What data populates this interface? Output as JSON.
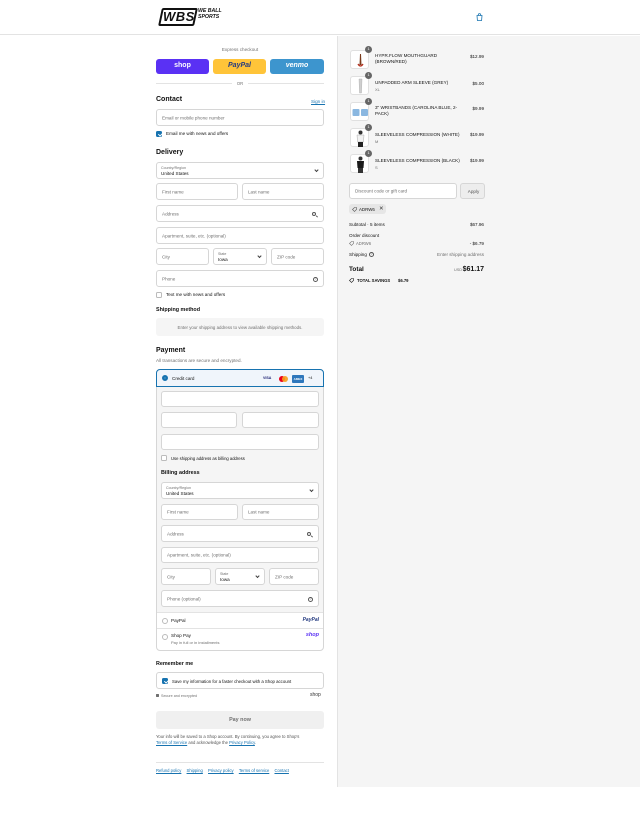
{
  "header": {
    "logo_main": "WBS",
    "logo_tag": "WE BALL SPORTS",
    "cart_icon": "shopping-bag-icon"
  },
  "express": {
    "title": "Express checkout",
    "shop_label": "shop",
    "paypal_label": "PayPal",
    "venmo_label": "venmo",
    "or_label": "OR",
    "colors": {
      "shop": "#5a31f4",
      "paypal": "#ffc439",
      "venmo": "#3d95ce"
    }
  },
  "contact": {
    "title": "Contact",
    "signin": "Sign in",
    "email_placeholder": "Email or mobile phone number",
    "news_label": "Email me with news and offers"
  },
  "delivery": {
    "title": "Delivery",
    "country_label": "Country/Region",
    "country_value": "United States",
    "first_name": "First name",
    "last_name": "Last name",
    "address": "Address",
    "apartment": "Apartment, suite, etc. (optional)",
    "city": "City",
    "state_label": "State",
    "state_value": "Iowa",
    "zip": "ZIP code",
    "phone": "Phone",
    "text_label": "Text me with news and offers"
  },
  "shipping": {
    "title": "Shipping method",
    "notice": "Enter your shipping address to view available shipping methods."
  },
  "payment": {
    "title": "Payment",
    "subtitle": "All transactions are secure and encrypted.",
    "credit_card": "Credit card",
    "card_brands": [
      "VISA",
      "MC",
      "AMEX",
      "+4"
    ],
    "use_shipping": "Use shipping address as billing address",
    "billing_title": "Billing address",
    "country_label": "Country/Region",
    "country_value": "United States",
    "first_name": "First name",
    "last_name": "Last name",
    "address": "Address",
    "apartment": "Apartment, suite, etc. (optional)",
    "city": "City",
    "state_label": "State",
    "state_value": "Iowa",
    "zip": "ZIP code",
    "phone": "Phone (optional)",
    "paypal": "PayPal",
    "paypal_logo": "PayPal",
    "shoppay": "Shop Pay",
    "shoppay_sub": "Pay in full or in installments",
    "shoppay_logo": "shop"
  },
  "remember": {
    "title": "Remember me",
    "save_label": "Save my information for a faster checkout with a Shop account",
    "secure": "Secure and encrypted",
    "shop_logo": "shop"
  },
  "pay_button": "Pay now",
  "legal": {
    "line1": "Your info will be saved to a Shop account. By continuing, you agree to Shop's",
    "terms": "Terms of Service",
    "middle": "and acknowledge the",
    "privacy": "Privacy Policy",
    "end": "."
  },
  "footer_links": [
    "Refund policy",
    "Shipping",
    "Privacy policy",
    "Terms of service",
    "Contact"
  ],
  "cart": {
    "items": [
      {
        "qty": "1",
        "name": "HYPR.FLOW MOUTHGUARD (BROWN/RED)",
        "variant": "",
        "price": "$12.99"
      },
      {
        "qty": "1",
        "name": "UNPADDED ARM SLEEVE (GREY)",
        "variant": "XL",
        "price": "$5.00"
      },
      {
        "qty": "1",
        "name": "3\" WRISTBANDS (CAROLINA BLUE, 2-PACK)",
        "variant": "",
        "price": "$9.99"
      },
      {
        "qty": "1",
        "name": "SLEEVELESS COMPRESSION (WHITE)",
        "variant": "M",
        "price": "$19.99"
      },
      {
        "qty": "1",
        "name": "SLEEVELESS COMPRESSION (BLACK)",
        "variant": "S",
        "price": "$19.99"
      }
    ],
    "discount_placeholder": "Discount code or gift card",
    "apply": "Apply",
    "code_tag": "ADRW6",
    "subtotal_label": "Subtotal · 5 items",
    "subtotal_value": "$67.96",
    "order_discount_label": "Order discount",
    "discount_code": "ADRW6",
    "discount_value": "- $6.79",
    "shipping_label": "Shipping",
    "shipping_value": "Enter shipping address",
    "total_label": "Total",
    "currency": "USD",
    "total_value": "$61.17",
    "savings_label": "TOTAL SAVINGS",
    "savings_value": "$6.79"
  }
}
